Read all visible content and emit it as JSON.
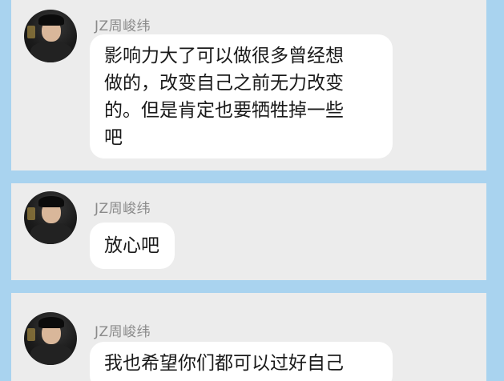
{
  "messages": [
    {
      "sender": "JZ周峻纬",
      "lines": [
        "影响力大了可以做很多曾经想",
        "做的，改变自己之前无力改变",
        "的。但是肯定也要牺牲掉一些",
        "吧"
      ]
    },
    {
      "sender": "JZ周峻纬",
      "lines": [
        "放心吧"
      ]
    },
    {
      "sender": "JZ周峻纬",
      "lines": [
        "我也希望你们都可以过好自己"
      ]
    }
  ]
}
